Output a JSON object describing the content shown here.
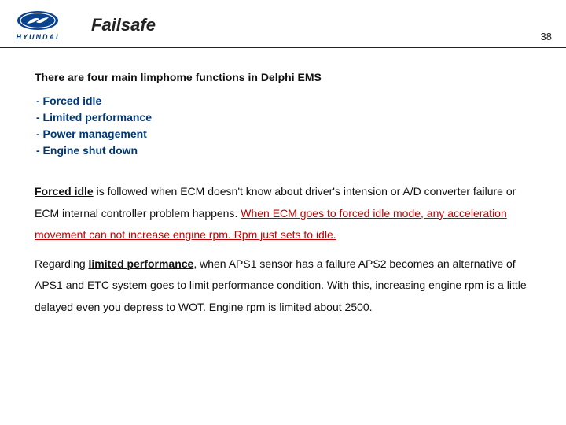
{
  "header": {
    "brand": "HYUNDAI",
    "title": "Failsafe",
    "page_number": "38"
  },
  "intro_heading": "There are four main limphome functions in Delphi EMS",
  "functions": [
    "- Forced idle",
    "- Limited performance",
    "- Power management",
    "- Engine shut down"
  ],
  "para1": {
    "term": "Forced idle",
    "rest1": " is followed when ECM doesn't know about driver's intension or A/D converter failure or ECM internal controller problem happens. ",
    "warn": "When ECM goes to forced idle mode, any acceleration movement can not increase engine rpm. Rpm just sets to idle.",
    "tail": ""
  },
  "para2": {
    "lead": "Regarding ",
    "term": "limited performance",
    "rest": ", when APS1 sensor has a failure APS2 becomes an alternative of APS1 and ETC system goes to limit performance condition. With this, increasing engine rpm is a little delayed even you depress to WOT. Engine rpm is limited about 2500."
  }
}
